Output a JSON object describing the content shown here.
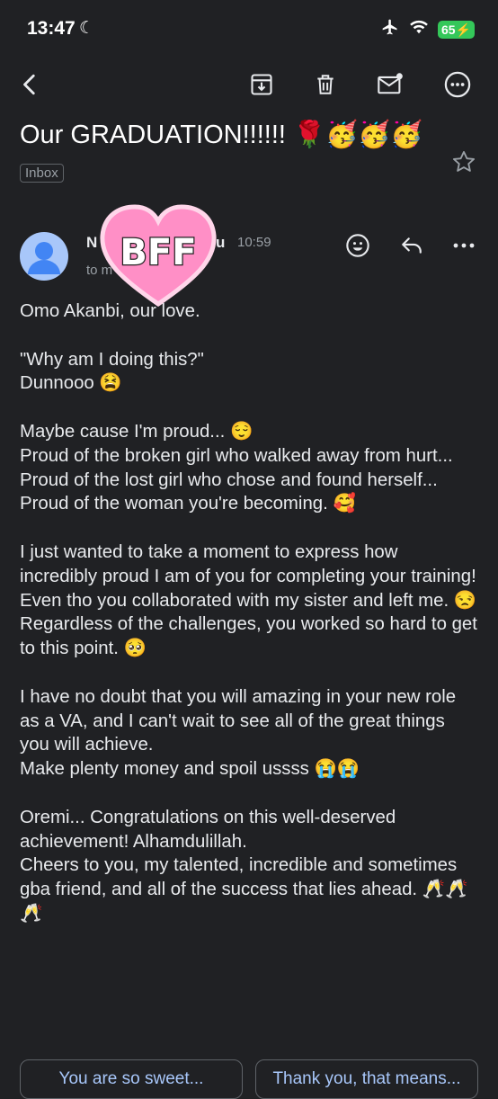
{
  "status_bar": {
    "time": "13:47",
    "battery": "65"
  },
  "email": {
    "subject": "Our GRADUATION!!!!!! 🌹🥳🥳🥳",
    "label": "Inbox",
    "sender_visible_start": "N",
    "sender_visible_end": "u",
    "time": "10:59",
    "recipients": "to m",
    "sticker_text": "BFF",
    "body": "Omo Akanbi, our love.\n\n\"Why am I doing this?\"\nDunnooo 😫\n\nMaybe cause I'm proud... 😌\nProud of the broken girl who walked away from hurt...\nProud of the lost girl who chose and found herself...\nProud of the woman you're becoming. 🥰\n\nI just wanted to take a moment to express how incredibly proud I am of you for completing your training! Even tho you collaborated with my sister and left me. 😒\nRegardless of the challenges, you worked so hard to get to this point. 🥺\n\nI have no doubt that you will amazing in your new role as a VA, and I can't wait to see all of the great things you will achieve.\nMake plenty money and spoil ussss 😭😭\n\nOremi... Congratulations on this well-deserved achievement! Alhamdulillah.\nCheers to you, my talented, incredible and sometimes gba friend, and all of the success that lies ahead. 🥂🥂🥂"
  },
  "smart_replies": [
    "You are so sweet...",
    "Thank you, that means..."
  ],
  "icons": {
    "back": "back-arrow-icon",
    "archive": "archive-icon",
    "delete": "trash-icon",
    "unread": "mark-unread-icon",
    "more": "more-circle-icon",
    "star": "star-icon",
    "react": "emoji-react-icon",
    "reply": "reply-icon",
    "overflow": "more-horizontal-icon"
  },
  "colors": {
    "background": "#202124",
    "text": "#e8eaed",
    "secondary": "#9aa0a6",
    "accent": "#a8c7fa",
    "sticker": "#ff8fc6"
  }
}
